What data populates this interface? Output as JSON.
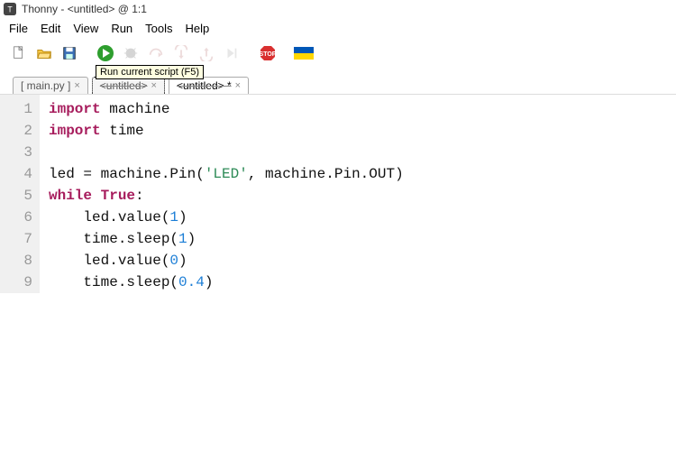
{
  "window": {
    "title": "Thonny  -  <untitled>  @  1:1"
  },
  "menu": {
    "file": "File",
    "edit": "Edit",
    "view": "View",
    "run": "Run",
    "tools": "Tools",
    "help": "Help"
  },
  "toolbar": {
    "new": "New",
    "open": "Open",
    "save": "Save",
    "run": "Run current script (F5)",
    "debug": "Debug",
    "step_over": "Step over",
    "step_into": "Step into",
    "step_out": "Step out",
    "resume": "Resume",
    "stop": "Stop",
    "support": "Support Ukraine",
    "tooltip": "Run current script (F5)"
  },
  "tabs": [
    {
      "label": "[ main.py ]",
      "active": false,
      "modified": false,
      "focused": false,
      "strike": false
    },
    {
      "label": "<untitled>",
      "active": false,
      "modified": false,
      "focused": true,
      "strike": true
    },
    {
      "label": "<untitled> *",
      "active": true,
      "modified": true,
      "focused": false,
      "strike": true
    }
  ],
  "code": {
    "lines": [
      {
        "n": 1,
        "tokens": [
          [
            "kw",
            "import"
          ],
          [
            "",
            " machine"
          ]
        ]
      },
      {
        "n": 2,
        "tokens": [
          [
            "kw",
            "import"
          ],
          [
            "",
            " time"
          ]
        ]
      },
      {
        "n": 3,
        "tokens": [
          [
            "",
            ""
          ]
        ]
      },
      {
        "n": 4,
        "tokens": [
          [
            "",
            "led = machine.Pin("
          ],
          [
            "str",
            "'LED'"
          ],
          [
            "",
            ", machine.Pin.OUT)"
          ]
        ]
      },
      {
        "n": 5,
        "tokens": [
          [
            "kw",
            "while"
          ],
          [
            "",
            " "
          ],
          [
            "kw",
            "True"
          ],
          [
            "",
            ":"
          ]
        ]
      },
      {
        "n": 6,
        "tokens": [
          [
            "",
            "    led.value("
          ],
          [
            "num",
            "1"
          ],
          [
            "",
            ")"
          ]
        ]
      },
      {
        "n": 7,
        "tokens": [
          [
            "",
            "    time.sleep("
          ],
          [
            "num",
            "1"
          ],
          [
            "",
            ")"
          ]
        ]
      },
      {
        "n": 8,
        "tokens": [
          [
            "",
            "    led.value("
          ],
          [
            "num",
            "0"
          ],
          [
            "",
            ")"
          ]
        ]
      },
      {
        "n": 9,
        "tokens": [
          [
            "",
            "    time.sleep("
          ],
          [
            "num",
            "0.4"
          ],
          [
            "",
            ")"
          ]
        ]
      }
    ]
  }
}
